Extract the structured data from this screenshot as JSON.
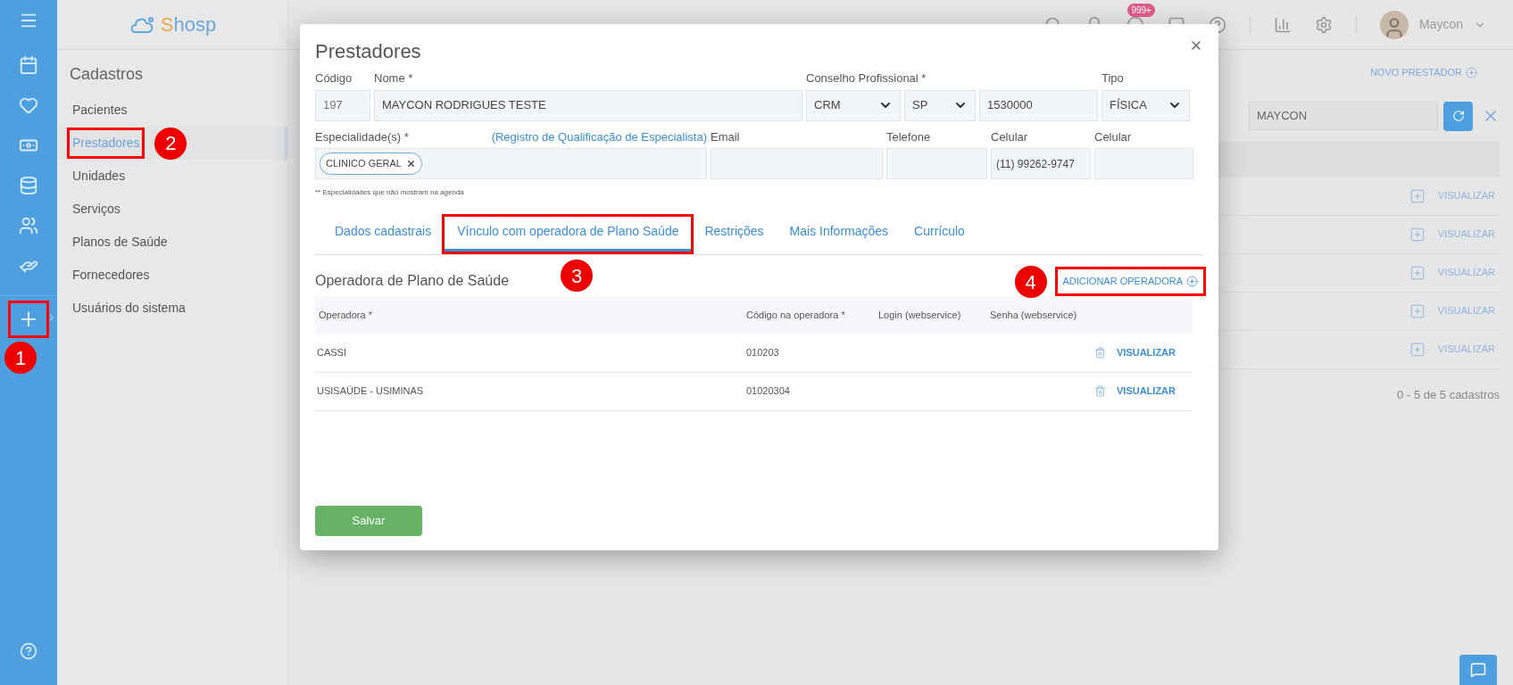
{
  "rail": {
    "add_button": {
      "highlighted": true,
      "callout": "1"
    }
  },
  "logo": {
    "text": "Shosp"
  },
  "nav": {
    "title": "Cadastros",
    "items": [
      {
        "label": "Pacientes",
        "selected": false,
        "highlighted": false
      },
      {
        "label": "Prestadores",
        "selected": true,
        "highlighted": true,
        "callout": "2"
      },
      {
        "label": "Unidades",
        "selected": false,
        "highlighted": false
      },
      {
        "label": "Serviços",
        "selected": false,
        "highlighted": false
      },
      {
        "label": "Planos de Saúde",
        "selected": false,
        "highlighted": false
      },
      {
        "label": "Fornecedores",
        "selected": false,
        "highlighted": false
      },
      {
        "label": "Usuários do sistema",
        "selected": false,
        "highlighted": false
      }
    ]
  },
  "header": {
    "badge": "999+",
    "user": "Maycon"
  },
  "background": {
    "new_button": "NOVO PRESTADOR",
    "search_value": "MAYCON",
    "row_actions": [
      "VISUALIZAR",
      "VISUALIZAR",
      "VISUALIZAR",
      "VISUALIZAR",
      "VISUALIZAR"
    ],
    "footer": "0 - 5 de 5 cadastros"
  },
  "modal": {
    "title": "Prestadores",
    "fields": {
      "codigo": {
        "label": "Código",
        "value": "197"
      },
      "nome": {
        "label": "Nome *",
        "value": "MAYCON RODRIGUES TESTE"
      },
      "conselho": {
        "label": "Conselho Profissional *",
        "value": "CRM"
      },
      "uf": {
        "value": "SP"
      },
      "numero": {
        "value": "1530000"
      },
      "tipo": {
        "label": "Tipo",
        "value": "FÍSICA"
      },
      "especialidade": {
        "label": "Especialidade(s) *",
        "link": "(Registro de Qualificação de Especialista)",
        "tags": [
          "CLINICO GERAL"
        ]
      },
      "email": {
        "label": "Email"
      },
      "telefone": {
        "label": "Telefone"
      },
      "celular": {
        "label": "Celular",
        "value": "(11) 99262-9747"
      },
      "celular2": {
        "label": "Celular"
      }
    },
    "footnote": "** Especialidades que não mostram na agenda",
    "tabs": [
      {
        "label": "Dados cadastrais",
        "selected": false,
        "highlighted": false
      },
      {
        "label": "Vínculo com operadora de Plano Saúde",
        "selected": true,
        "highlighted": true,
        "callout": "3"
      },
      {
        "label": "Restrições",
        "selected": false,
        "highlighted": false
      },
      {
        "label": "Mais Informações",
        "selected": false,
        "highlighted": false
      },
      {
        "label": "Currículo",
        "selected": false,
        "highlighted": false
      }
    ],
    "section_title": "Operadora de Plano de Saúde",
    "add_button": {
      "label": "ADICIONAR OPERADORA",
      "highlighted": true,
      "callout": "4"
    },
    "table": {
      "columns": [
        "Operadora *",
        "Código na operadora *",
        "Login (webservice)",
        "Senha (webservice)"
      ],
      "rows": [
        {
          "operadora": "CASSI",
          "codigo": "010203",
          "action": "VISUALIZAR"
        },
        {
          "operadora": "USISAÚDE - USIMINAS",
          "codigo": "01020304",
          "action": "VISUALIZAR"
        }
      ]
    },
    "save_button": "Salvar"
  }
}
